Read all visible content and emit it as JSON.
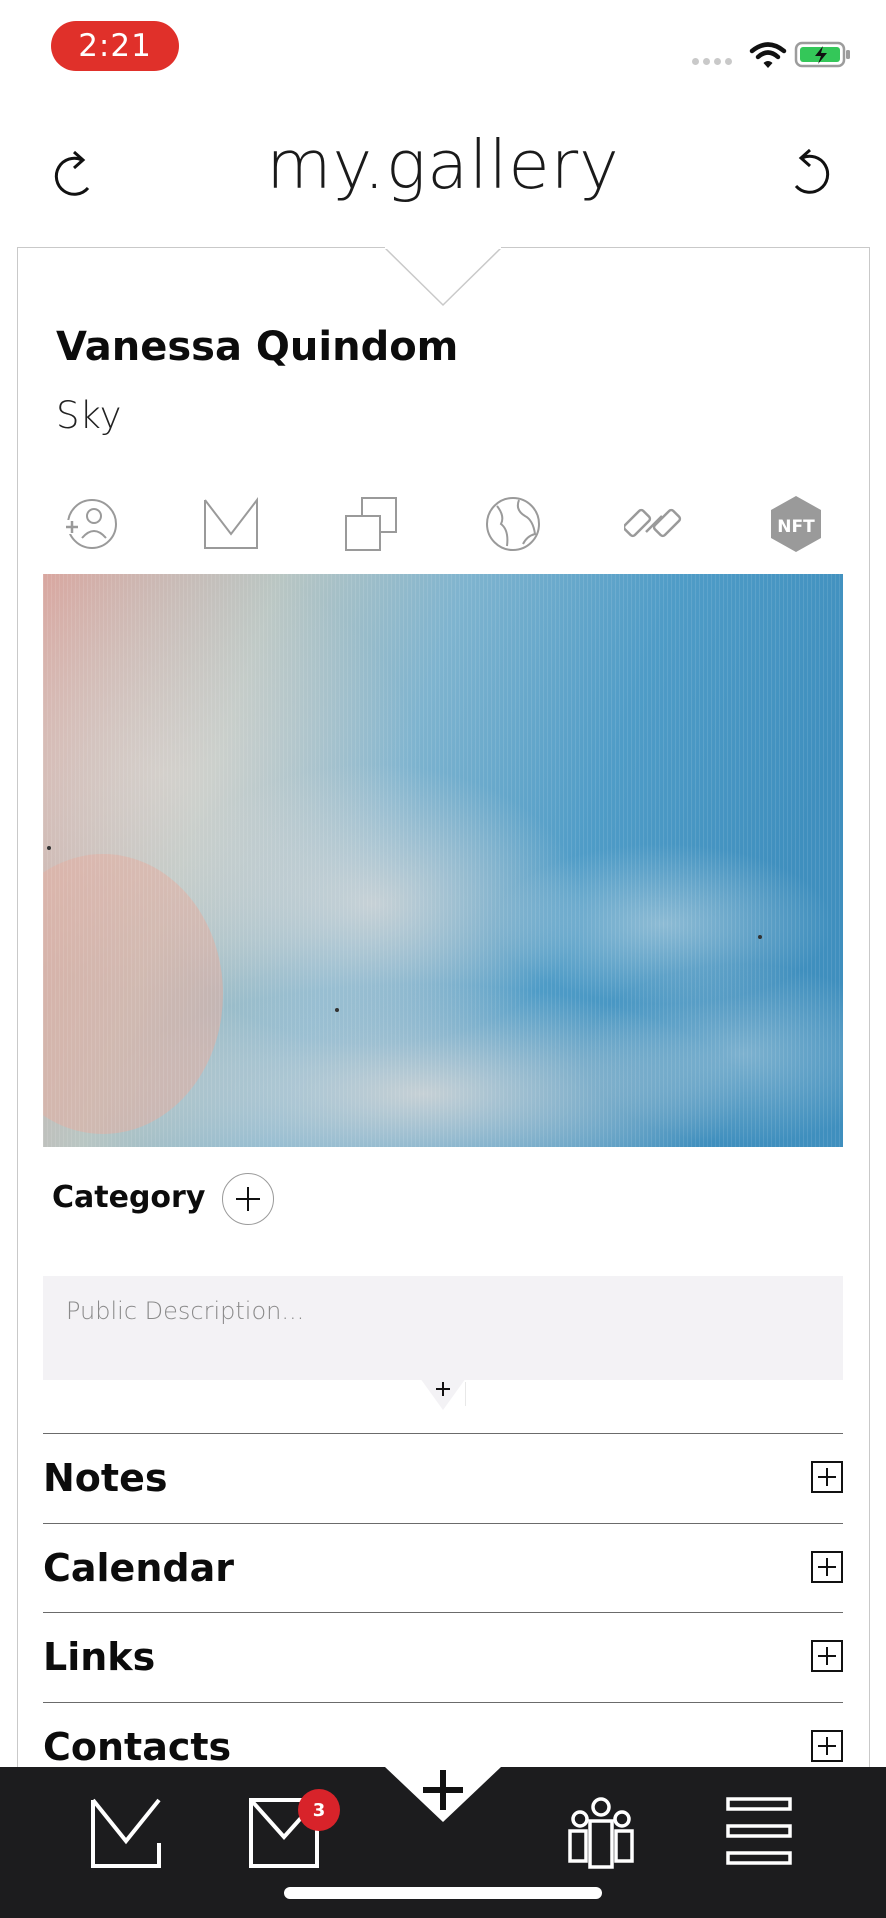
{
  "status_bar": {
    "time": "2:21"
  },
  "header": {
    "title": "my.gallery"
  },
  "artwork": {
    "owner_name": "Vanessa Quindom",
    "title": "Sky"
  },
  "toolbar": {
    "icons": [
      "add-contact-icon",
      "mail-icon",
      "copy-icon",
      "globe-icon",
      "link-icon",
      "nft-icon"
    ]
  },
  "category": {
    "label": "Category"
  },
  "description": {
    "placeholder": "Public Description..."
  },
  "sections": [
    {
      "label": "Notes"
    },
    {
      "label": "Calendar"
    },
    {
      "label": "Links"
    },
    {
      "label": "Contacts"
    }
  ],
  "tab_bar": {
    "inbox_badge": "3"
  },
  "colors": {
    "accent": "#e0302a",
    "tab_bar": "#1c1c1e",
    "badge": "#d8232a"
  }
}
